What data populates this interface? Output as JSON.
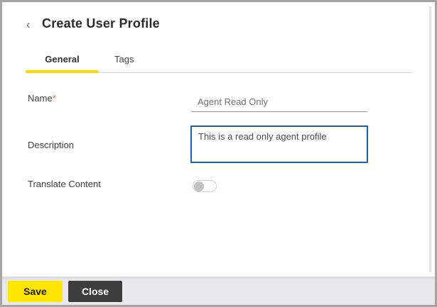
{
  "colors": {
    "accent_yellow": "#ffe600",
    "tab_underline_yellow": "#ffd800",
    "focus_blue": "#1767b3",
    "dark_button_bg": "#3d3d3d",
    "window_border": "#a5a5a5",
    "footer_bg": "#e9e9eb",
    "required_marker_red": "#e05c5c"
  },
  "header": {
    "back_icon": "‹",
    "title": "Create User Profile"
  },
  "tabs": [
    {
      "label": "General",
      "active": true
    },
    {
      "label": "Tags",
      "active": false
    }
  ],
  "form": {
    "name": {
      "label": "Name",
      "required_marker": "*",
      "value": "Agent Read Only"
    },
    "description": {
      "label": "Description",
      "value": "This is a read only agent profile"
    },
    "translate": {
      "label": "Translate Content",
      "state": "off"
    }
  },
  "footer": {
    "save_label": "Save",
    "close_label": "Close"
  }
}
